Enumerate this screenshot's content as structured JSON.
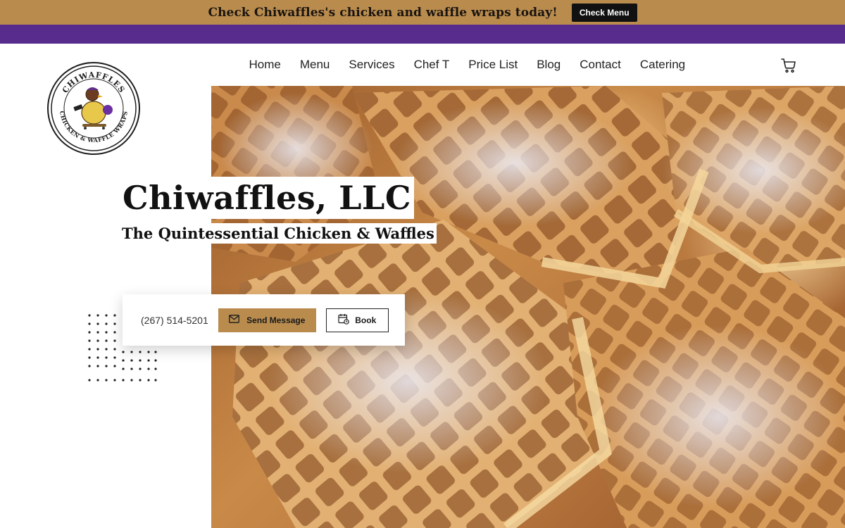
{
  "promo": {
    "text": "Check Chiwaffles's chicken and waffle wraps today!",
    "button_label": "Check Menu"
  },
  "logo": {
    "alt_text": "CHIWAFFLES CHICKEN & WAFFLE WRAPS"
  },
  "nav": {
    "items": [
      {
        "label": "Home"
      },
      {
        "label": "Menu"
      },
      {
        "label": "Services"
      },
      {
        "label": "Chef T"
      },
      {
        "label": "Price List"
      },
      {
        "label": "Blog"
      },
      {
        "label": "Contact"
      },
      {
        "label": "Catering"
      }
    ],
    "cart_icon": "cart-icon"
  },
  "hero": {
    "title": "Chiwaffles, LLC",
    "subtitle": "The Quintessential Chicken & Waffles"
  },
  "contact": {
    "phone": "(267) 514-5201",
    "send_label": "Send Message",
    "book_label": "Book",
    "send_icon": "mail-icon",
    "book_icon": "calendar-icon"
  },
  "colors": {
    "promo_bar": "#b98c4e",
    "accent_bar": "#572c8c",
    "button_gold": "#b98c4e",
    "text_dark": "#111111"
  }
}
